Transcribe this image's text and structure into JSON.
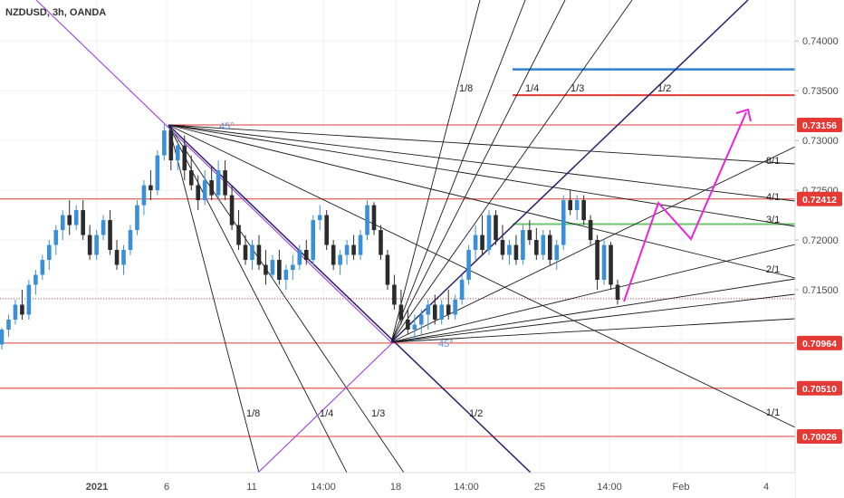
{
  "header": {
    "title": "NZDUSD, 3h, OANDA"
  },
  "colors": {
    "bull": "#3a8fd9",
    "bear": "#2b2b2b",
    "horizontal_line": "#e53935",
    "fan_line": "#1a1a1a",
    "diagonal_purple": "#9b3de0",
    "diagonal_navy": "#2a1f6b",
    "blue_line": "#2f80d0",
    "green_line": "#6cc46c",
    "projection": "#ee22dd",
    "price_tag": "#e53935",
    "angle_label": "#5b8fdc"
  },
  "chart_data": {
    "type": "candlestick",
    "symbol": "NZDUSD",
    "timeframe": "3h",
    "source": "OANDA",
    "ylim": [
      0.6975,
      0.744
    ],
    "x_ticks": [
      "2021",
      "6",
      "11",
      "14:00",
      "18",
      "14:00",
      "25",
      "14:00",
      "Feb",
      "4"
    ],
    "y_ticks": [
      "0.74000",
      "0.73500",
      "0.73000",
      "0.72500",
      "0.72000",
      "0.71500"
    ],
    "price_tags": [
      "0.73156",
      "0.72412",
      "0.70964",
      "0.70510",
      "0.70026"
    ],
    "levels": [
      0.73156,
      0.72412,
      0.70964,
      0.7051,
      0.70026
    ],
    "blue_level": 0.73715,
    "red_top_level": 0.73455,
    "green_level": 0.7216,
    "last_price_level": 0.7141,
    "fan_labels_high": [
      "8/1",
      "4/1",
      "3/1",
      "2/1",
      "1/1"
    ],
    "fan_labels_low": [
      "1/8",
      "1/4",
      "1/3",
      "1/2"
    ],
    "fan_labels_top": [
      "1/8",
      "1/4",
      "1/3",
      "1/2"
    ],
    "angle_labels": [
      "45°",
      "45°"
    ],
    "candles": [
      [
        0.7095,
        0.7112,
        0.709,
        0.711
      ],
      [
        0.711,
        0.7125,
        0.7103,
        0.712
      ],
      [
        0.712,
        0.714,
        0.7115,
        0.7135
      ],
      [
        0.7135,
        0.715,
        0.712,
        0.7125
      ],
      [
        0.7125,
        0.716,
        0.712,
        0.7155
      ],
      [
        0.7155,
        0.717,
        0.7145,
        0.7165
      ],
      [
        0.7165,
        0.7185,
        0.716,
        0.718
      ],
      [
        0.718,
        0.72,
        0.717,
        0.7195
      ],
      [
        0.7195,
        0.7215,
        0.7185,
        0.721
      ],
      [
        0.721,
        0.723,
        0.72,
        0.7225
      ],
      [
        0.7225,
        0.724,
        0.7205,
        0.7215
      ],
      [
        0.7215,
        0.7235,
        0.721,
        0.723
      ],
      [
        0.723,
        0.724,
        0.72,
        0.7205
      ],
      [
        0.7205,
        0.7215,
        0.718,
        0.7185
      ],
      [
        0.7185,
        0.721,
        0.718,
        0.7205
      ],
      [
        0.7205,
        0.7225,
        0.72,
        0.722
      ],
      [
        0.722,
        0.723,
        0.7185,
        0.719
      ],
      [
        0.719,
        0.72,
        0.717,
        0.7175
      ],
      [
        0.7175,
        0.7195,
        0.7165,
        0.719
      ],
      [
        0.719,
        0.7215,
        0.7185,
        0.721
      ],
      [
        0.721,
        0.724,
        0.7205,
        0.7235
      ],
      [
        0.7235,
        0.726,
        0.7225,
        0.7255
      ],
      [
        0.7255,
        0.727,
        0.724,
        0.725
      ],
      [
        0.725,
        0.729,
        0.7245,
        0.7285
      ],
      [
        0.7285,
        0.7316,
        0.728,
        0.731
      ],
      [
        0.731,
        0.7315,
        0.727,
        0.728
      ],
      [
        0.728,
        0.73,
        0.727,
        0.7295
      ],
      [
        0.7295,
        0.7305,
        0.726,
        0.727
      ],
      [
        0.727,
        0.7285,
        0.725,
        0.7255
      ],
      [
        0.7255,
        0.7265,
        0.723,
        0.724
      ],
      [
        0.724,
        0.727,
        0.7235,
        0.726
      ],
      [
        0.726,
        0.7275,
        0.724,
        0.7245
      ],
      [
        0.7245,
        0.728,
        0.724,
        0.727
      ],
      [
        0.727,
        0.728,
        0.724,
        0.7245
      ],
      [
        0.7245,
        0.7255,
        0.721,
        0.7215
      ],
      [
        0.7215,
        0.723,
        0.719,
        0.7195
      ],
      [
        0.7195,
        0.7205,
        0.7175,
        0.718
      ],
      [
        0.718,
        0.72,
        0.717,
        0.7195
      ],
      [
        0.7195,
        0.7205,
        0.717,
        0.7175
      ],
      [
        0.7175,
        0.719,
        0.7155,
        0.7165
      ],
      [
        0.7165,
        0.7185,
        0.716,
        0.718
      ],
      [
        0.718,
        0.719,
        0.7155,
        0.716
      ],
      [
        0.716,
        0.7175,
        0.715,
        0.717
      ],
      [
        0.717,
        0.7185,
        0.716,
        0.7175
      ],
      [
        0.7175,
        0.7195,
        0.717,
        0.719
      ],
      [
        0.719,
        0.72,
        0.7175,
        0.718
      ],
      [
        0.718,
        0.7225,
        0.7175,
        0.722
      ],
      [
        0.722,
        0.7235,
        0.721,
        0.7225
      ],
      [
        0.7225,
        0.723,
        0.719,
        0.7195
      ],
      [
        0.7195,
        0.72,
        0.717,
        0.7175
      ],
      [
        0.7175,
        0.719,
        0.7165,
        0.7185
      ],
      [
        0.7185,
        0.72,
        0.7175,
        0.7195
      ],
      [
        0.7195,
        0.7205,
        0.718,
        0.7185
      ],
      [
        0.7185,
        0.721,
        0.718,
        0.7205
      ],
      [
        0.7205,
        0.724,
        0.72,
        0.7235
      ],
      [
        0.7235,
        0.7238,
        0.7205,
        0.721
      ],
      [
        0.721,
        0.7215,
        0.718,
        0.7185
      ],
      [
        0.7185,
        0.719,
        0.715,
        0.7155
      ],
      [
        0.7155,
        0.7165,
        0.713,
        0.7135
      ],
      [
        0.7135,
        0.715,
        0.7115,
        0.712
      ],
      [
        0.712,
        0.713,
        0.7105,
        0.711
      ],
      [
        0.711,
        0.7125,
        0.7098,
        0.7115
      ],
      [
        0.7115,
        0.713,
        0.7105,
        0.7125
      ],
      [
        0.7125,
        0.714,
        0.711,
        0.7135
      ],
      [
        0.7135,
        0.7145,
        0.7115,
        0.712
      ],
      [
        0.712,
        0.714,
        0.7115,
        0.7135
      ],
      [
        0.7135,
        0.715,
        0.712,
        0.7125
      ],
      [
        0.7125,
        0.7145,
        0.712,
        0.714
      ],
      [
        0.714,
        0.7165,
        0.7135,
        0.716
      ],
      [
        0.716,
        0.7195,
        0.7155,
        0.719
      ],
      [
        0.719,
        0.7215,
        0.718,
        0.7205
      ],
      [
        0.7205,
        0.7225,
        0.7185,
        0.719
      ],
      [
        0.719,
        0.723,
        0.7185,
        0.7225
      ],
      [
        0.7225,
        0.723,
        0.7195,
        0.72
      ],
      [
        0.72,
        0.7215,
        0.718,
        0.7185
      ],
      [
        0.7185,
        0.72,
        0.7175,
        0.7195
      ],
      [
        0.7195,
        0.7205,
        0.7175,
        0.718
      ],
      [
        0.718,
        0.7215,
        0.7175,
        0.721
      ],
      [
        0.721,
        0.722,
        0.7195,
        0.72
      ],
      [
        0.72,
        0.7212,
        0.718,
        0.7185
      ],
      [
        0.7185,
        0.721,
        0.718,
        0.7205
      ],
      [
        0.7205,
        0.721,
        0.7175,
        0.718
      ],
      [
        0.718,
        0.72,
        0.717,
        0.7195
      ],
      [
        0.7195,
        0.7245,
        0.719,
        0.724
      ],
      [
        0.724,
        0.725,
        0.7225,
        0.723
      ],
      [
        0.723,
        0.7245,
        0.722,
        0.724
      ],
      [
        0.724,
        0.7245,
        0.7215,
        0.722
      ],
      [
        0.722,
        0.7225,
        0.7195,
        0.72
      ],
      [
        0.72,
        0.7205,
        0.715,
        0.716
      ],
      [
        0.716,
        0.72,
        0.7155,
        0.7195
      ],
      [
        0.7195,
        0.7198,
        0.715,
        0.7155
      ],
      [
        0.7155,
        0.716,
        0.7135,
        0.714
      ]
    ]
  }
}
